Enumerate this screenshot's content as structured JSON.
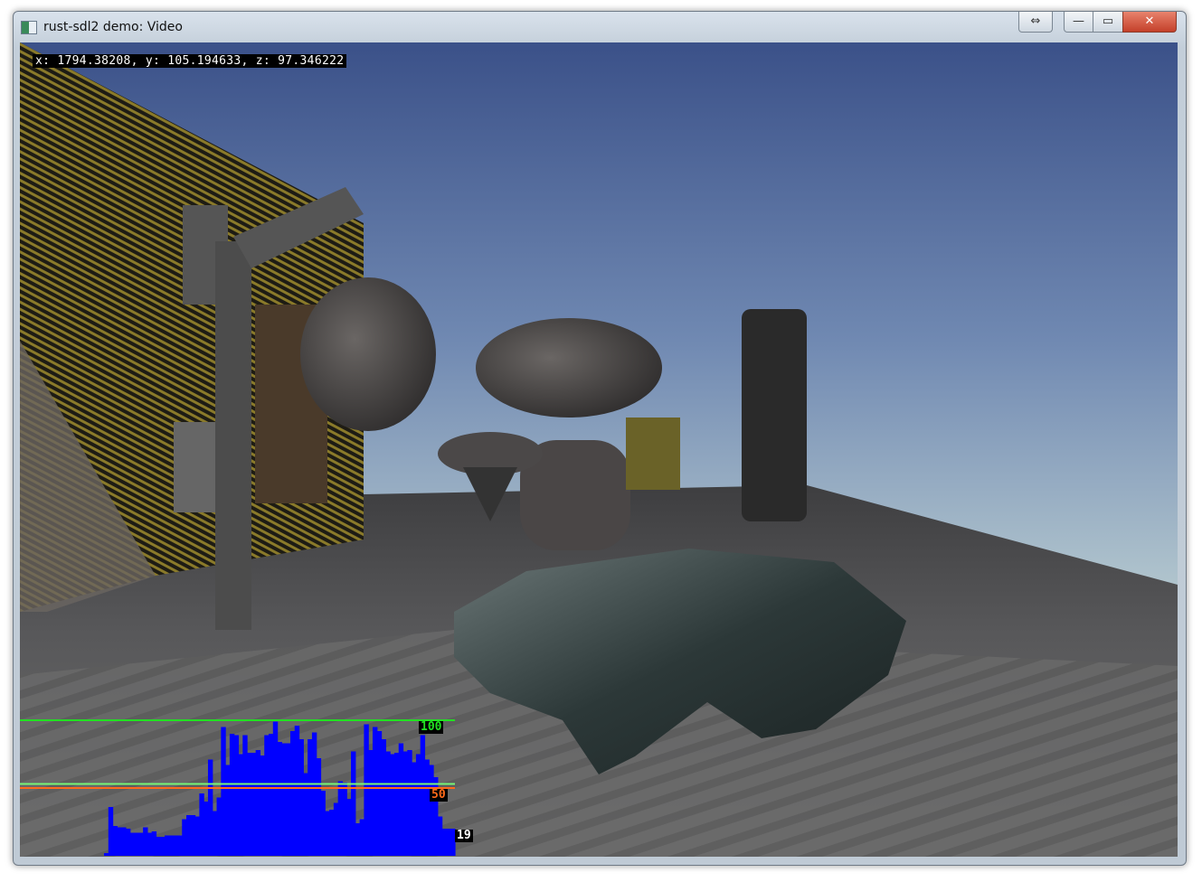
{
  "window": {
    "title": "rust-sdl2 demo: Video",
    "icon": "app-window-icon",
    "controls": {
      "extra": "⇔",
      "minimize": "—",
      "maximize": "▭",
      "close": "✕"
    }
  },
  "hud": {
    "coordinates": "x: 1794.38208, y: 105.194633, z: 97.346222"
  },
  "colors": {
    "sky_top": "#3b5189",
    "sky_horizon": "#a9bfcc",
    "ground": "#5a5a5c",
    "graph_bars": "#0000ff",
    "line_100": "#22e022",
    "line_avg": "#77f577",
    "line_50": "#ff6a1a"
  },
  "chart_data": {
    "type": "bar",
    "title": "",
    "ylim": [
      0,
      100
    ],
    "reference_lines": [
      {
        "value": 100,
        "label": "100",
        "color": "#22e022"
      },
      {
        "value": 53,
        "label": "",
        "color": "#77f577"
      },
      {
        "value": 50,
        "label": "50",
        "color": "#ff6a1a"
      }
    ],
    "current_label": "19",
    "values": [
      2,
      36,
      22,
      21,
      21,
      20,
      17,
      17,
      17,
      21,
      17,
      18,
      14,
      14,
      15,
      15,
      15,
      15,
      27,
      30,
      30,
      29,
      46,
      40,
      71,
      33,
      43,
      95,
      67,
      90,
      89,
      75,
      89,
      76,
      76,
      78,
      74,
      89,
      90,
      99,
      84,
      83,
      83,
      92,
      96,
      86,
      61,
      86,
      91,
      72,
      48,
      33,
      34,
      39,
      55,
      54,
      42,
      77,
      24,
      27,
      97,
      78,
      95,
      92,
      86,
      77,
      75,
      76,
      83,
      77,
      78,
      69,
      75,
      89,
      71,
      67,
      58,
      29,
      20,
      20,
      20
    ]
  }
}
